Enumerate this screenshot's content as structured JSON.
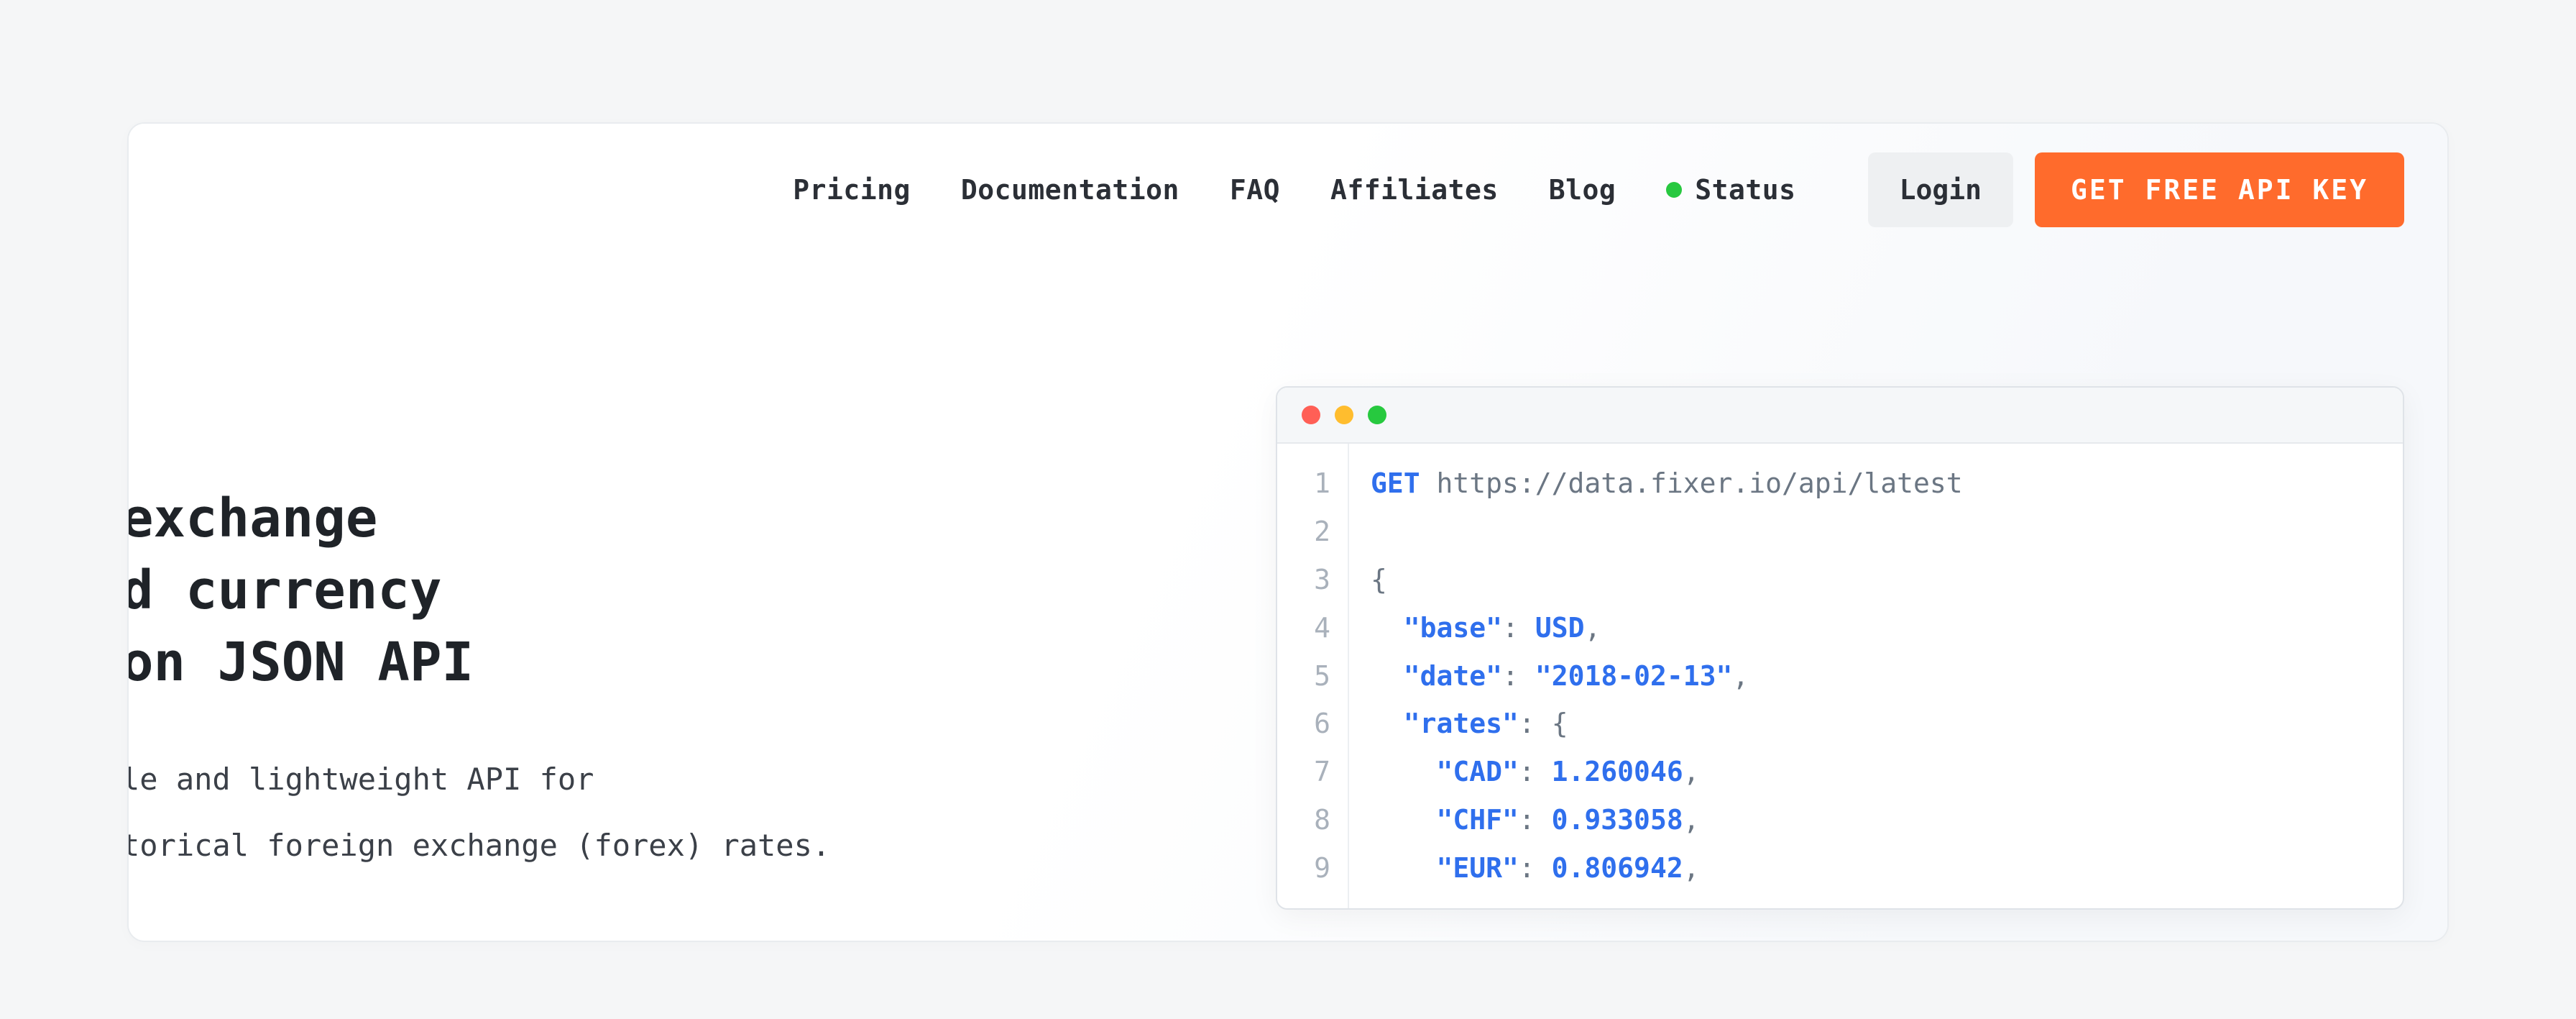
{
  "nav": {
    "links": {
      "pricing": "Pricing",
      "documentation": "Documentation",
      "faq": "FAQ",
      "affiliates": "Affiliates",
      "blog": "Blog",
      "status": "Status"
    },
    "login": "Login",
    "cta": "GET FREE API KEY"
  },
  "hero": {
    "title_line1": "exchange",
    "title_line2": "d currency",
    "title_line3": "on JSON API",
    "desc_line1": "le and lightweight API for",
    "desc_line2": "torical foreign exchange (forex) rates."
  },
  "code": {
    "method": "GET",
    "url": "https://data.fixer.io/api/latest",
    "lines": {
      "n1": "1",
      "n2": "2",
      "n3": "3",
      "n4": "4",
      "n5": "5",
      "n6": "6",
      "n7": "7",
      "n8": "8",
      "n9": "9"
    },
    "brace_open": "{",
    "keys": {
      "base": "\"base\"",
      "date": "\"date\"",
      "rates": "\"rates\"",
      "cad": "\"CAD\"",
      "chf": "\"CHF\"",
      "eur": "\"EUR\""
    },
    "values": {
      "base": "USD",
      "date": "\"2018-02-13\"",
      "cad": "1.260046",
      "chf": "0.933058",
      "eur": "0.806942"
    },
    "colon": ": ",
    "comma": ",",
    "rates_brace": "{"
  }
}
